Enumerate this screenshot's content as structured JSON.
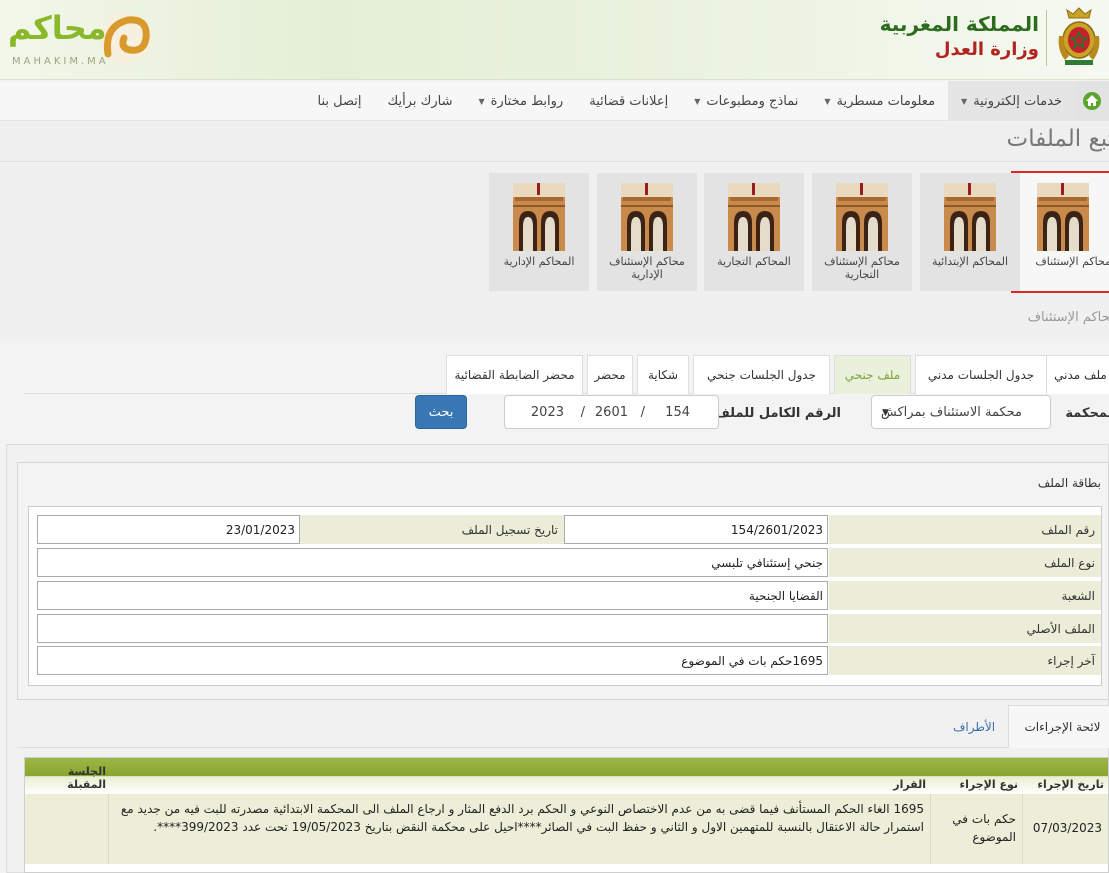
{
  "header": {
    "kingdom": "المملكة المغربية",
    "ministry": "وزارة العدل",
    "logo_ar": "محاكم",
    "logo_en": "MAHAKIM.MA",
    "brand_green": "#2d6b1f",
    "brand_red": "#b1241f"
  },
  "nav": {
    "home_icon": "home-icon",
    "items": [
      {
        "label": "خدمات إلكترونية",
        "dropdown": true
      },
      {
        "label": "معلومات مسطرية",
        "dropdown": true
      },
      {
        "label": "نماذج ومطبوعات",
        "dropdown": true
      },
      {
        "label": "إعلانات قضائية",
        "dropdown": false
      },
      {
        "label": "روابط مختارة",
        "dropdown": true
      },
      {
        "label": "شارك برأيك",
        "dropdown": false
      },
      {
        "label": "إتصل بنا",
        "dropdown": false
      }
    ]
  },
  "page": {
    "title": "تتبع الملفات",
    "section": "محاكم الإستئناف"
  },
  "courts": [
    {
      "label": "محاكم الإستئناف",
      "selected": true
    },
    {
      "label": "المحاكم الإبتدائية",
      "selected": false
    },
    {
      "label": "محاكم الإستئناف التجارية",
      "selected": false
    },
    {
      "label": "المحاكم التجارية",
      "selected": false
    },
    {
      "label": "محاكم الإستئناف الإدارية",
      "selected": false
    },
    {
      "label": "المحاكم الإدارية",
      "selected": false
    }
  ],
  "tabs": [
    {
      "label": "ملف مدني",
      "active": false
    },
    {
      "label": "جدول الجلسات مدني",
      "active": false
    },
    {
      "label": "ملف جنحي",
      "active": true
    },
    {
      "label": "جدول الجلسات جنحي",
      "active": false
    },
    {
      "label": "شكاية",
      "active": false
    },
    {
      "label": "محضر",
      "active": false
    },
    {
      "label": "محضر الضابطة القضائية",
      "active": false
    }
  ],
  "search": {
    "court_label": "المحكمة",
    "court_value": "محكمة الاستئناف بمراكش",
    "full_number_label": "الرقم الكامل للملف",
    "number": "154",
    "code": "2601",
    "year": "2023",
    "separator": "/",
    "button": "بحث"
  },
  "file_card": {
    "title": "بطاقة الملف",
    "number_label": "رقم الملف",
    "number_value": "154/2601/2023",
    "reg_date_label": "تاريخ تسجيل الملف",
    "reg_date_value": "23/01/2023",
    "type_label": "نوع الملف",
    "type_value": "جنحي إستئنافي تلبسي",
    "division_label": "الشعبة",
    "division_value": "القضايا الجنحية",
    "original_label": "الملف الأصلي",
    "original_value": "",
    "last_action_label": "آخر إجراء",
    "last_action_value": "1695حكم بات في الموضوع"
  },
  "bottom_tabs": {
    "actions": "لائحة الإجراءات",
    "parties": "الأطراف"
  },
  "actions_table": {
    "headers": [
      "تاريخ الإجراء",
      "نوع الإجراء",
      "القرار",
      "الجلسة المقبلة"
    ],
    "rows": [
      {
        "date": "07/03/2023",
        "type": "حكم بات في الموضوع",
        "decision": "1695 الغاء الحكم المستأنف فيما قضى به من عدم الاختصاص النوعي و الحكم برد الدفع المثار و ارجاع الملف الى المحكمة الابتدائية مصدرته للبت فيه من جديد مع استمرار حالة الاعتقال بالنسبة للمتهمين الاول و الثاني و حفظ البت في الصائر****احيل على محكمة النقض بتاريخ 19/05/2023 تحت عدد 399/2023****.",
        "next_session": ""
      }
    ]
  }
}
